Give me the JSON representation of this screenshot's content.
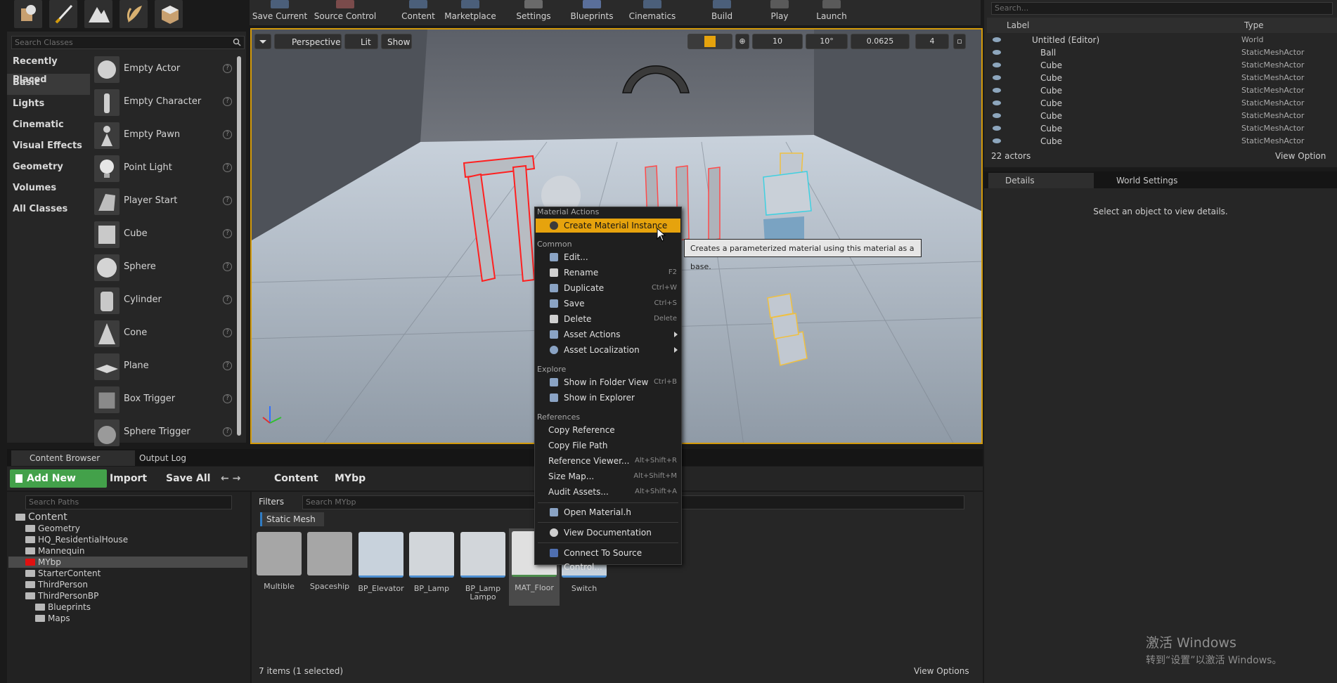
{
  "place_panel": {
    "search_placeholder": "Search Classes",
    "categories": [
      "Recently Placed",
      "Basic",
      "Lights",
      "Cinematic",
      "Visual Effects",
      "Geometry",
      "Volumes",
      "All Classes"
    ],
    "active_category": "Basic",
    "classes": [
      "Empty Actor",
      "Empty Character",
      "Empty Pawn",
      "Point Light",
      "Player Start",
      "Cube",
      "Sphere",
      "Cylinder",
      "Cone",
      "Plane",
      "Box Trigger",
      "Sphere Trigger"
    ]
  },
  "toolbar": {
    "buttons": [
      "Save Current",
      "Source Control",
      "Content",
      "Marketplace",
      "Settings",
      "Blueprints",
      "Cinematics",
      "Build",
      "Play",
      "Launch"
    ]
  },
  "viewport": {
    "perspective_label": "Perspective",
    "lit_label": "Lit",
    "show_label": "Show",
    "grid_snap": "10",
    "rotation_snap": "10°",
    "scale_snap": "0.0625",
    "camera_speed": "4"
  },
  "context_menu": {
    "sections": {
      "material_actions": "Material Actions",
      "common": "Common",
      "explore": "Explore",
      "references": "References"
    },
    "create_material_instance": "Create Material Instance",
    "common_items": [
      {
        "label": "Edit...",
        "shortcut": ""
      },
      {
        "label": "Rename",
        "shortcut": "F2"
      },
      {
        "label": "Duplicate",
        "shortcut": "Ctrl+W"
      },
      {
        "label": "Save",
        "shortcut": "Ctrl+S"
      },
      {
        "label": "Delete",
        "shortcut": "Delete"
      },
      {
        "label": "Asset Actions",
        "shortcut": ""
      },
      {
        "label": "Asset Localization",
        "shortcut": ""
      }
    ],
    "explore_items": [
      {
        "label": "Show in Folder View",
        "shortcut": "Ctrl+B"
      },
      {
        "label": "Show in Explorer",
        "shortcut": ""
      }
    ],
    "reference_items": [
      {
        "label": "Copy Reference",
        "shortcut": ""
      },
      {
        "label": "Copy File Path",
        "shortcut": ""
      },
      {
        "label": "Reference Viewer...",
        "shortcut": "Alt+Shift+R"
      },
      {
        "label": "Size Map...",
        "shortcut": "Alt+Shift+M"
      },
      {
        "label": "Audit Assets...",
        "shortcut": "Alt+Shift+A"
      }
    ],
    "open_material_h": "Open Material.h",
    "view_documentation": "View Documentation",
    "connect_source_control": "Connect To Source Control...",
    "tooltip": "Creates a parameterized material using this material as a base."
  },
  "content_browser": {
    "tab_content_browser": "Content Browser",
    "tab_output_log": "Output Log",
    "add_new": "Add New",
    "import": "Import",
    "save_all": "Save All",
    "breadcrumb_content": "Content",
    "breadcrumb_folder": "MYbp",
    "search_paths_placeholder": "Search Paths",
    "filters_label": "Filters",
    "search_assets_placeholder": "Search MYbp",
    "filter_chip": "Static Mesh",
    "tree": [
      {
        "label": "Content",
        "indent": 0
      },
      {
        "label": "Geometry",
        "indent": 1
      },
      {
        "label": "HQ_ResidentialHouse",
        "indent": 1
      },
      {
        "label": "Mannequin",
        "indent": 1
      },
      {
        "label": "MYbp",
        "indent": 1,
        "selected": true
      },
      {
        "label": "StarterContent",
        "indent": 1
      },
      {
        "label": "ThirdPerson",
        "indent": 1
      },
      {
        "label": "ThirdPersonBP",
        "indent": 1
      },
      {
        "label": "Blueprints",
        "indent": 2
      },
      {
        "label": "Maps",
        "indent": 2
      }
    ],
    "assets": [
      "Multible",
      "Spaceship",
      "BP_Elevator",
      "BP_Lamp",
      "BP_Lamp Lampo",
      "MAT_Floor",
      "Switch"
    ],
    "status": "7 items (1 selected)",
    "view_options": "View Options"
  },
  "outliner": {
    "search_placeholder": "Search...",
    "col_label": "Label",
    "col_type": "Type",
    "rows": [
      {
        "label": "Untitled (Editor)",
        "type": "World"
      },
      {
        "label": "Ball",
        "type": "StaticMeshActor"
      },
      {
        "label": "Cube",
        "type": "StaticMeshActor"
      },
      {
        "label": "Cube",
        "type": "StaticMeshActor"
      },
      {
        "label": "Cube",
        "type": "StaticMeshActor"
      },
      {
        "label": "Cube",
        "type": "StaticMeshActor"
      },
      {
        "label": "Cube",
        "type": "StaticMeshActor"
      },
      {
        "label": "Cube",
        "type": "StaticMeshActor"
      },
      {
        "label": "Cube",
        "type": "StaticMeshActor"
      }
    ],
    "actor_count": "22 actors",
    "view_options": "View Option"
  },
  "details": {
    "tab_details": "Details",
    "tab_world_settings": "World Settings",
    "empty_message": "Select an object to view details."
  },
  "watermark": {
    "line1": "激活 Windows",
    "line2": "转到“设置”以激活 Windows。"
  },
  "colors": {
    "accent": "#e6a30d",
    "add_new_green": "#43a14a",
    "selection_red": "#ff2020"
  }
}
